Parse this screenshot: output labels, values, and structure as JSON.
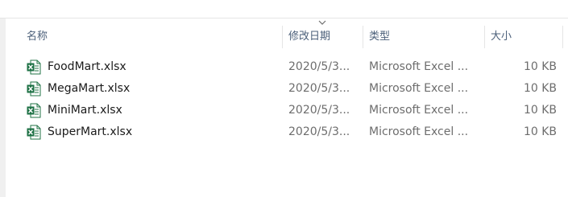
{
  "columns": {
    "name": "名称",
    "modified": "修改日期",
    "type": "类型",
    "size": "大小"
  },
  "files": [
    {
      "name": "FoodMart.xlsx",
      "modified": "2020/5/3...",
      "type": "Microsoft Excel ...",
      "size": "10 KB",
      "icon": "excel-file-icon"
    },
    {
      "name": "MegaMart.xlsx",
      "modified": "2020/5/3...",
      "type": "Microsoft Excel ...",
      "size": "10 KB",
      "icon": "excel-file-icon"
    },
    {
      "name": "MiniMart.xlsx",
      "modified": "2020/5/3...",
      "type": "Microsoft Excel ...",
      "size": "10 KB",
      "icon": "excel-file-icon"
    },
    {
      "name": "SuperMart.xlsx",
      "modified": "2020/5/3...",
      "type": "Microsoft Excel ...",
      "size": "10 KB",
      "icon": "excel-file-icon"
    }
  ],
  "colors": {
    "header_text": "#4c607a",
    "excel_green": "#1e7145",
    "separator": "#e5e5e5"
  }
}
